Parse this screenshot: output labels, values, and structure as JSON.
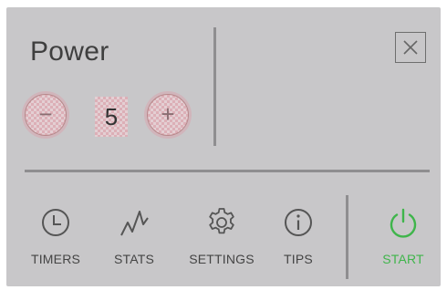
{
  "power": {
    "title": "Power",
    "value": "5",
    "minus_label": "−",
    "plus_label": "+"
  },
  "close": {
    "icon": "close-icon"
  },
  "nav": {
    "items": [
      {
        "id": "timers",
        "label": "TIMERS",
        "icon": "clock-icon"
      },
      {
        "id": "stats",
        "label": "STATS",
        "icon": "chart-line-icon"
      },
      {
        "id": "settings",
        "label": "SETTINGS",
        "icon": "gear-icon"
      },
      {
        "id": "tips",
        "label": "TIPS",
        "icon": "info-icon"
      },
      {
        "id": "start",
        "label": "START",
        "icon": "power-icon",
        "color": "#3fb54b"
      }
    ]
  },
  "colors": {
    "panel": "#c8c7c9",
    "accent_green": "#3fb54b",
    "divider": "#8f8e90"
  }
}
